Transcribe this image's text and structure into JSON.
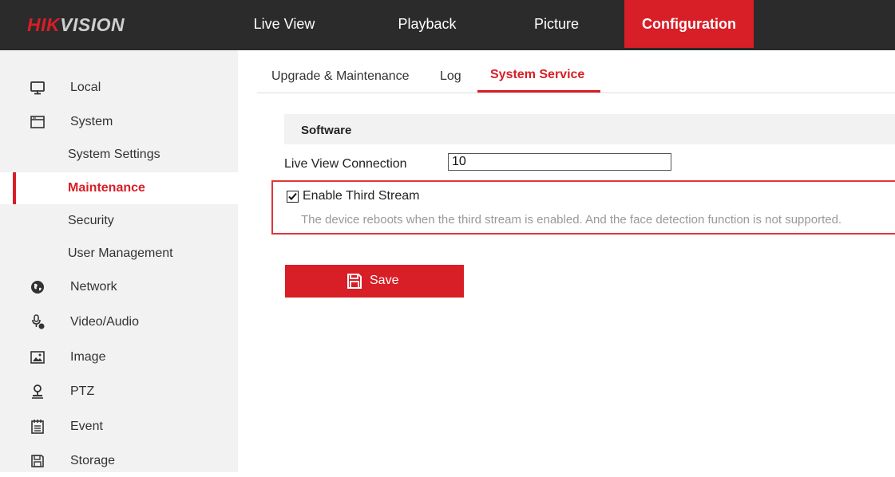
{
  "header": {
    "logo_part1": "HIK",
    "logo_part2": "VISION",
    "tabs": [
      {
        "label": "Live View"
      },
      {
        "label": "Playback"
      },
      {
        "label": "Picture"
      },
      {
        "label": "Configuration",
        "active": true
      }
    ]
  },
  "sidebar": {
    "items": [
      {
        "label": "Local",
        "icon": "monitor-icon"
      },
      {
        "label": "System",
        "icon": "window-icon"
      },
      {
        "label": "System Settings"
      },
      {
        "label": "Maintenance",
        "active": true
      },
      {
        "label": "Security"
      },
      {
        "label": "User Management"
      },
      {
        "label": "Network",
        "icon": "globe-icon"
      },
      {
        "label": "Video/Audio",
        "icon": "microphone-icon"
      },
      {
        "label": "Image",
        "icon": "image-icon"
      },
      {
        "label": "PTZ",
        "icon": "ptz-icon"
      },
      {
        "label": "Event",
        "icon": "calendar-icon"
      },
      {
        "label": "Storage",
        "icon": "floppy-icon"
      }
    ]
  },
  "subtabs": [
    {
      "label": "Upgrade & Maintenance"
    },
    {
      "label": "Log"
    },
    {
      "label": "System Service",
      "active": true
    }
  ],
  "software": {
    "section_title": "Software",
    "live_view_connection_label": "Live View Connection",
    "live_view_connection_value": "10",
    "third_stream_label": "Enable Third Stream",
    "third_stream_checked": true,
    "third_stream_note": "The device reboots when the third stream is enabled. And the face detection function is not supported."
  },
  "actions": {
    "save_label": "Save"
  },
  "colors": {
    "accent": "#d81e26",
    "topbar": "#2b2b2b",
    "sidebar_bg": "#f2f2f2",
    "note_text": "#999999"
  }
}
